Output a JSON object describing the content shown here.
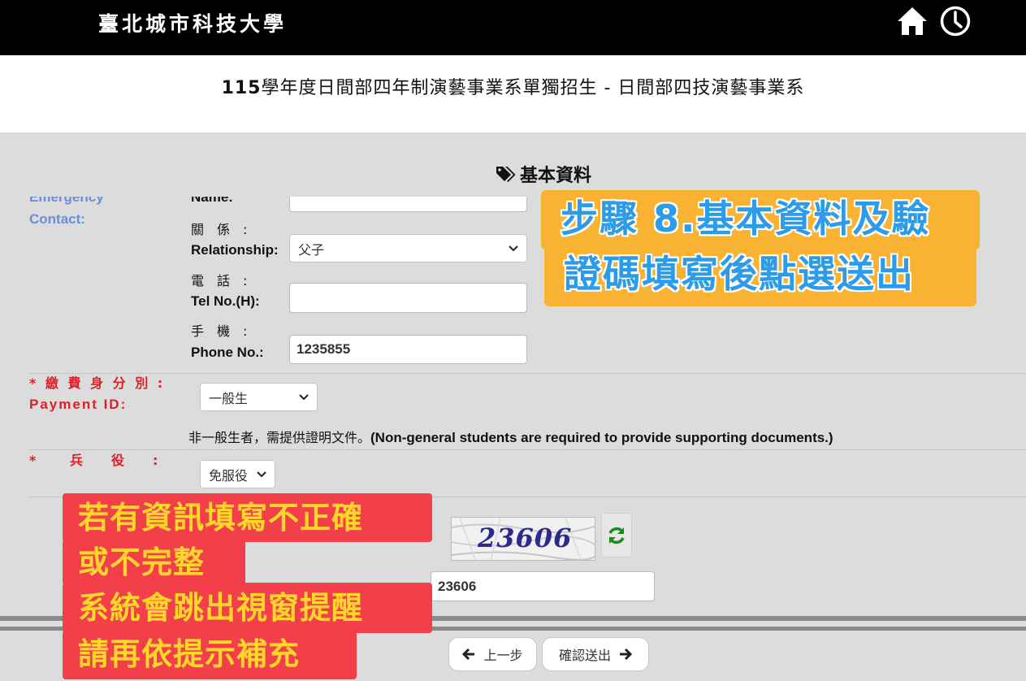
{
  "header": {
    "school_name": "臺北城市科技大學",
    "title_prefix": "115",
    "title_rest": "學年度日間部四年制演藝事業系單獨招生 - 日間部四技演藝事業系"
  },
  "section": {
    "title": "基本資料",
    "icon": "tags-icon"
  },
  "form": {
    "emergency_label_cut": "Emergency",
    "emergency_label": "Contact:",
    "name_label_cut": "Name:",
    "relationship_label_zh": "關　係　:",
    "relationship_label_en": "Relationship:",
    "relationship_value": "父子",
    "tel_label_zh": "電　話　:",
    "tel_label_en": "Tel No.(H):",
    "tel_value": "",
    "phone_label_zh": "手　機　:",
    "phone_label_en": "Phone No.:",
    "phone_value": "1235855",
    "payment_label_zh": "* 繳 費 身 分 別 :",
    "payment_label_en": "Payment ID:",
    "payment_value": "一般生",
    "note_zh": "非一般生者，需提供證明文件。",
    "note_en": "(Non-general students are required to provide supporting documents.)",
    "military_label_star": "*",
    "military_label": "兵　　役　　:",
    "military_value": "免服役",
    "captcha_image_text": "23606",
    "captcha_value": "23606"
  },
  "buttons": {
    "prev": "上一步",
    "submit": "確認送出"
  },
  "callouts": {
    "step_line1": "步驟 8.基本資料及驗",
    "step_line2": "證碼填寫後點選送出",
    "warn_line1": "若有資訊填寫不正確",
    "warn_line2": "或不完整",
    "warn_line3": "系統會跳出視窗提醒",
    "warn_line4": "請再依提示補充"
  },
  "colors": {
    "header_bg": "#000000",
    "panel_bg": "#dcdcdc",
    "label_blue": "#6b8ed8",
    "label_red": "#d9222a",
    "callout_yellow": "#f7b331",
    "callout_text_blue": "#2c9be8",
    "callout_red": "#f23f4a",
    "callout_text_yellow": "#ffd62a",
    "refresh_green": "#1a8a1a"
  }
}
